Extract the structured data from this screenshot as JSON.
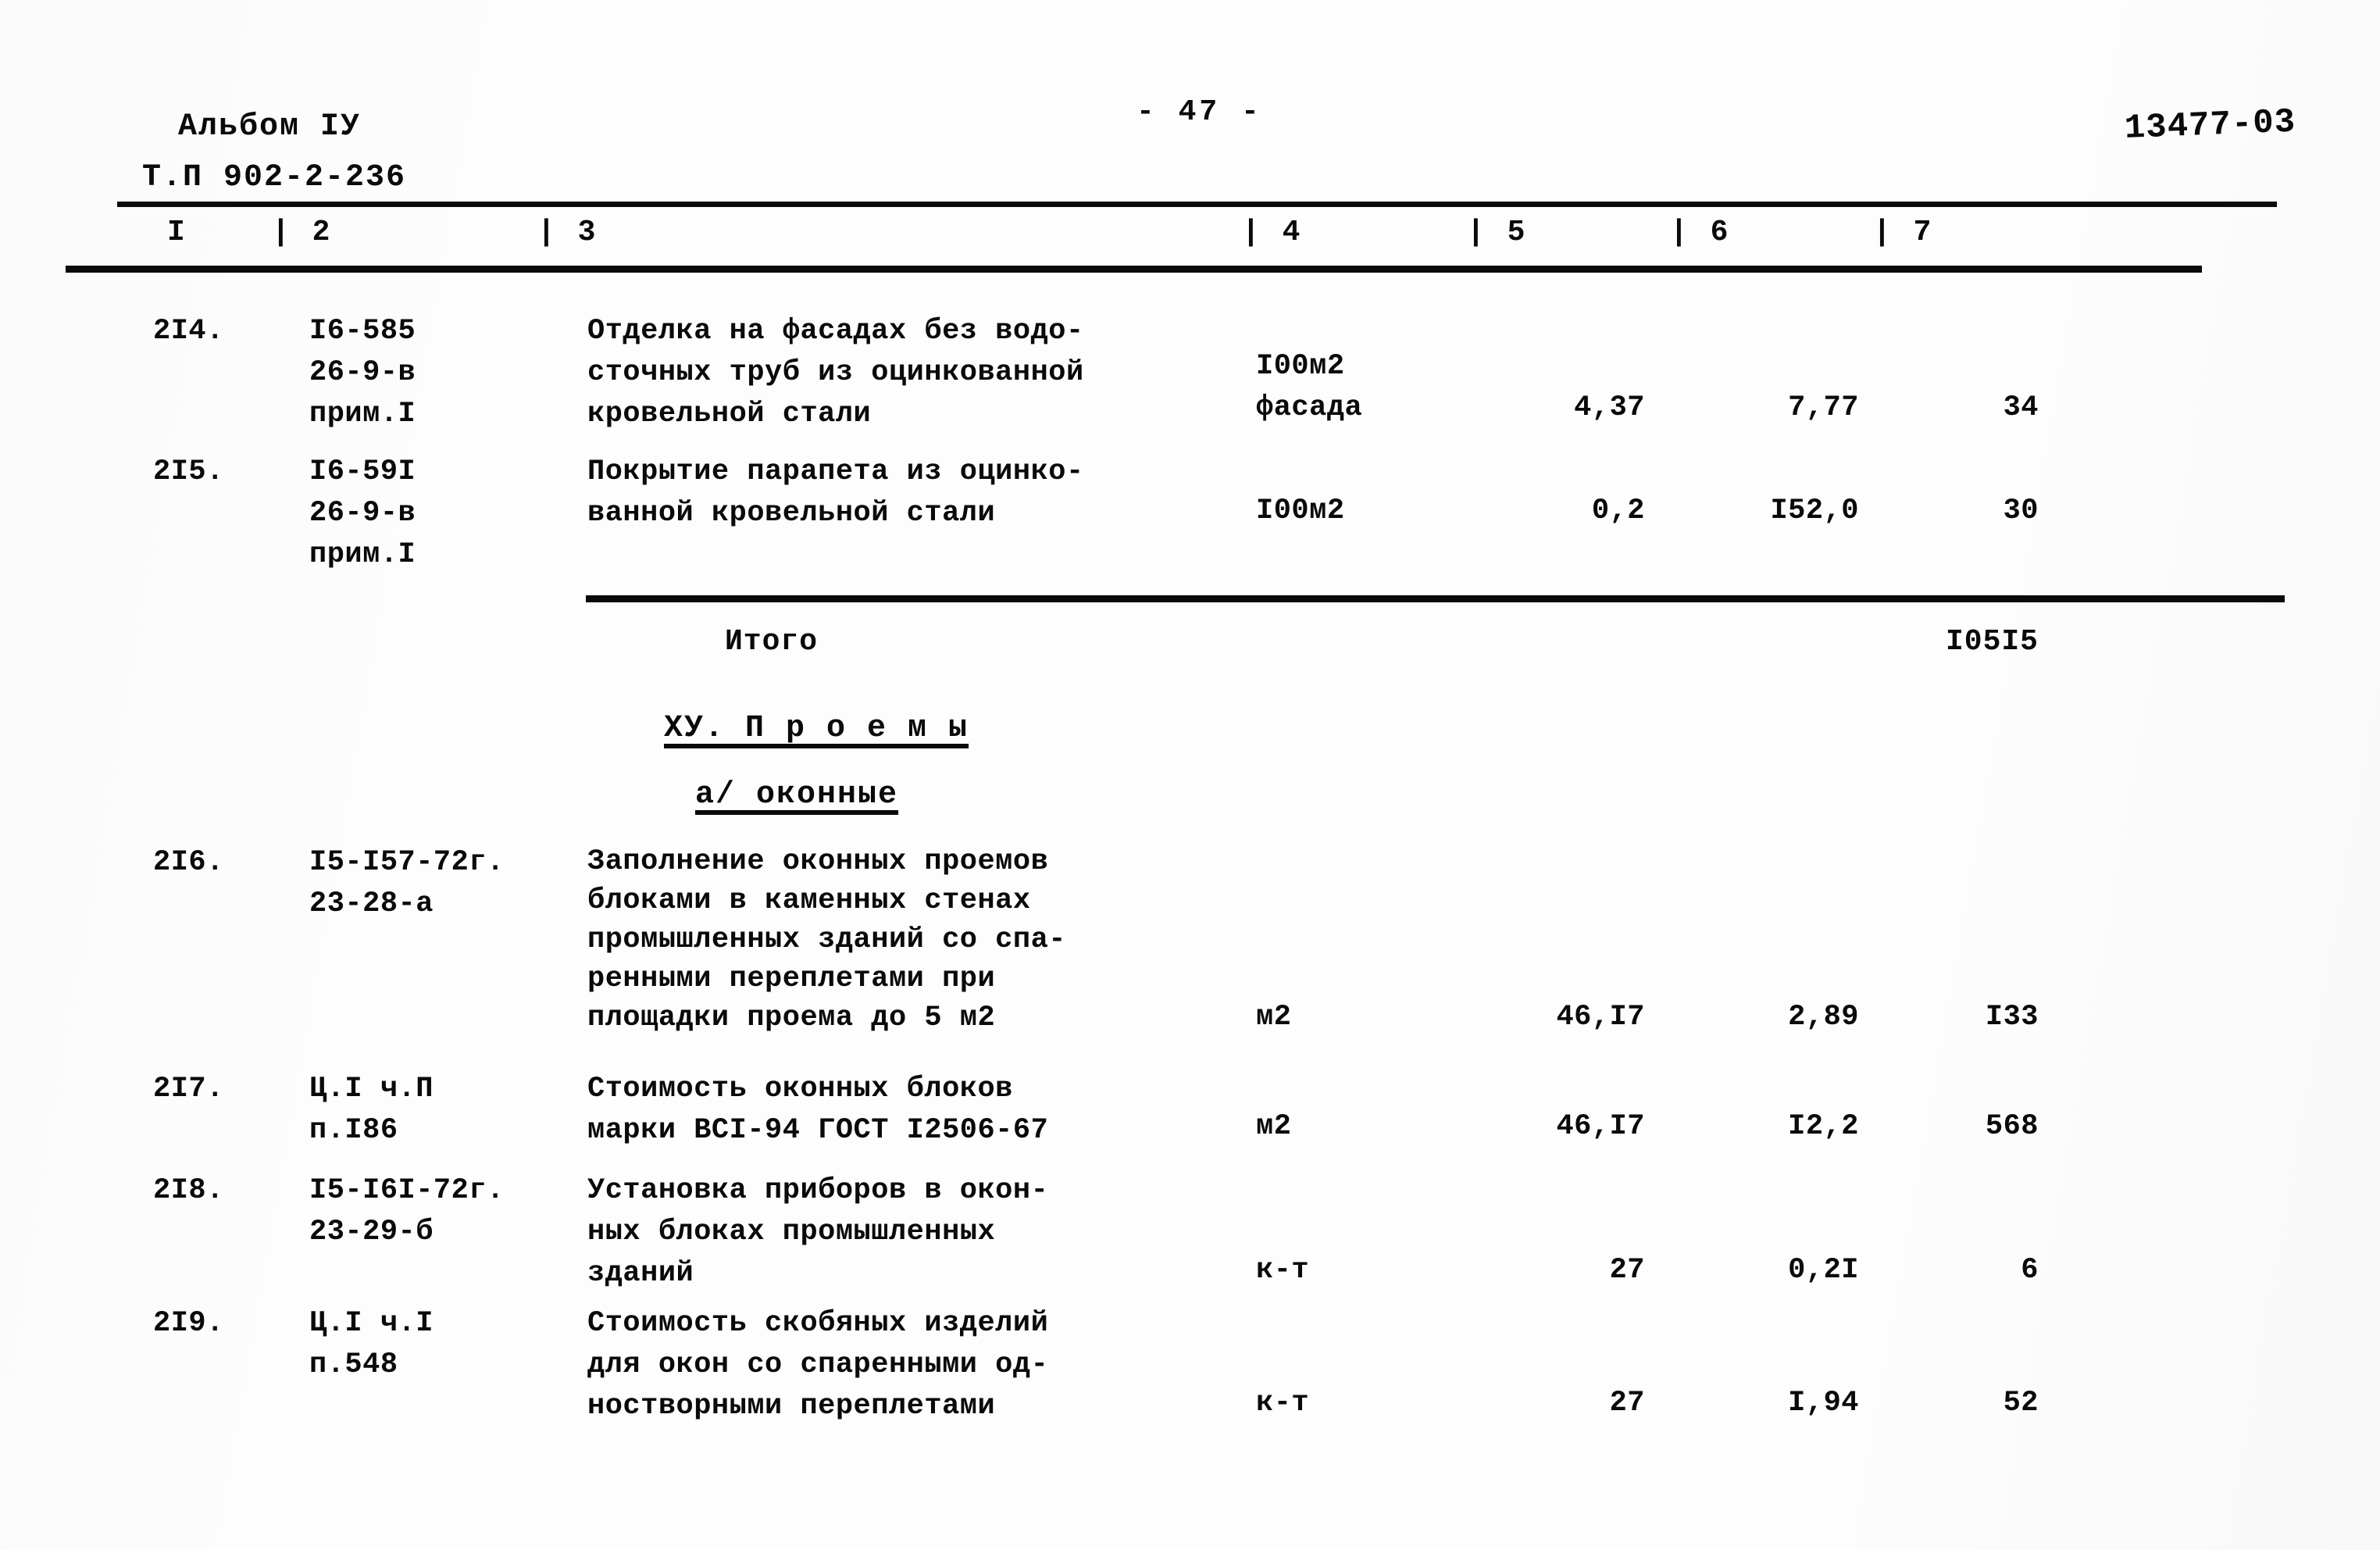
{
  "header": {
    "album": "Альбом IУ",
    "project": "Т.П 902-2-236",
    "page_number": "- 47 -",
    "doc_stamp": "13477-03"
  },
  "table": {
    "column_headers": [
      "I",
      "| 2",
      "| 3",
      "| 4",
      "| 5",
      "| 6",
      "| 7"
    ],
    "rows": [
      {
        "number": "2I4.",
        "code": "I6-585\n26-9-в\nприм.I",
        "description": "Отделка на фасадах без водо-\nсточных труб из оцинкованной\nкровельной стали",
        "unit": "I00м2\nфасада",
        "quantity": "4,37",
        "price": "7,77",
        "sum": "34"
      },
      {
        "number": "2I5.",
        "code": "I6-59I\n26-9-в\nприм.I",
        "description": "Покрытие парапета из оцинко-\nванной кровельной стали",
        "unit": "I00м2",
        "quantity": "0,2",
        "price": "I52,0",
        "sum": "30"
      }
    ],
    "total": {
      "label": "Итого",
      "value": "I05I5"
    },
    "sections": [
      {
        "title": "ХУ. П р о е м ы"
      },
      {
        "title": "а/ оконные"
      }
    ],
    "rows2": [
      {
        "number": "2I6.",
        "code": "I5-I57-72г.\n23-28-а",
        "description": "Заполнение оконных проемов\nблоками  в каменных стенах\nпромышленных зданий со спа-\nренными переплетами при\nплощадки проема до 5 м2",
        "unit": "м2",
        "quantity": "46,I7",
        "price": "2,89",
        "sum": "I33"
      },
      {
        "number": "2I7.",
        "code": "Ц.I ч.П\nп.I86",
        "description": "Стоимость оконных блоков\nмарки ВСI-94 ГОСТ I2506-67",
        "unit": "м2",
        "quantity": "46,I7",
        "price": "I2,2",
        "sum": "568"
      },
      {
        "number": "2I8.",
        "code": "I5-I6I-72г.\n23-29-б",
        "description": "Установка приборов в окон-\nных блоках промышленных\nзданий",
        "unit": "к-т",
        "quantity": "27",
        "price": "0,2I",
        "sum": "6"
      },
      {
        "number": "2I9.",
        "code": "Ц.I ч.I\nп.548",
        "description": "Стоимость скобяных изделий\nдля окон со спаренными од-\nностворными переплетами",
        "unit": "к-т",
        "quantity": "27",
        "price": "I,94",
        "sum": "52"
      }
    ]
  }
}
